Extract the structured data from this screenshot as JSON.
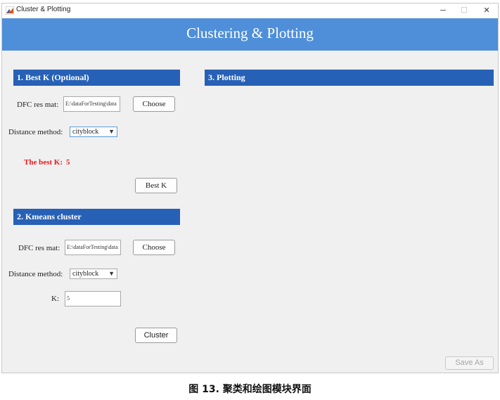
{
  "window": {
    "title": "Cluster & Plotting",
    "minimize_glyph": "─",
    "maximize_glyph": "☐",
    "close_glyph": "✕"
  },
  "banner": {
    "title": "Clustering & Plotting"
  },
  "best_k": {
    "header": "1. Best K (Optional)",
    "dfc_label": "DFC res mat:",
    "dfc_value": "E:\\dataForTesting\\data",
    "choose_label": "Choose",
    "distance_label": "Distance method:",
    "distance_value": "cityblock",
    "result_label": "The best K:",
    "result_value": "5",
    "button_label": "Best K"
  },
  "kmeans": {
    "header": "2. Kmeans cluster",
    "dfc_label": "DFC res mat:",
    "dfc_value": "E:\\dataForTesting\\data",
    "choose_label": "Choose",
    "distance_label": "Distance method:",
    "distance_value": "cityblock",
    "k_label": "K:",
    "k_value": "5",
    "button_label": "Cluster"
  },
  "plotting": {
    "header": "3. Plotting",
    "save_as_label": "Save As"
  },
  "caption": "图 13.  聚类和绘图模块界面",
  "colors": {
    "banner": "#4f8fd9",
    "section_header": "#2761b6",
    "result_text": "#e8191b"
  },
  "icons": {
    "app": "matlab-icon",
    "dropdown": "triangle-down-icon"
  }
}
